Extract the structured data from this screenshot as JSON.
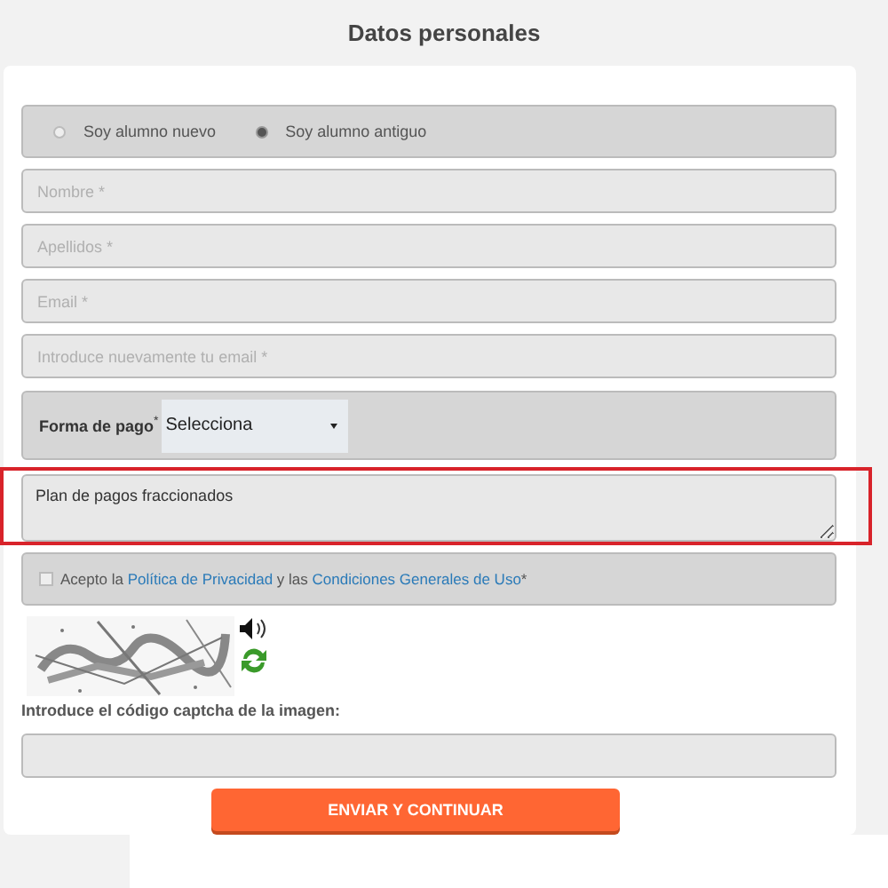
{
  "title": "Datos personales",
  "student_type": [
    {
      "label": "Soy alumno nuevo",
      "selected": false
    },
    {
      "label": "Soy alumno antiguo",
      "selected": true
    }
  ],
  "fields": [
    {
      "placeholder": "Nombre *"
    },
    {
      "placeholder": "Apellidos *"
    },
    {
      "placeholder": "Email *"
    },
    {
      "placeholder": "Introduce nuevamente tu email *"
    }
  ],
  "payment": {
    "label": "Forma de pago",
    "required_mark": "*",
    "value": "Selecciona"
  },
  "notes": {
    "value": "Plan de pagos fraccionados",
    "highlighted": true
  },
  "terms": {
    "checked": false,
    "text_before": "Acepto la",
    "link_1": "Política de Privacidad",
    "text_middle": "y las",
    "link_2": "Condiciones Generales de Uso",
    "required_mark": "*"
  },
  "captcha": {
    "kind": "picture",
    "label": "Introduce el código captcha de la imagen:"
  },
  "submit": "ENVIAR Y CONTINUAR"
}
